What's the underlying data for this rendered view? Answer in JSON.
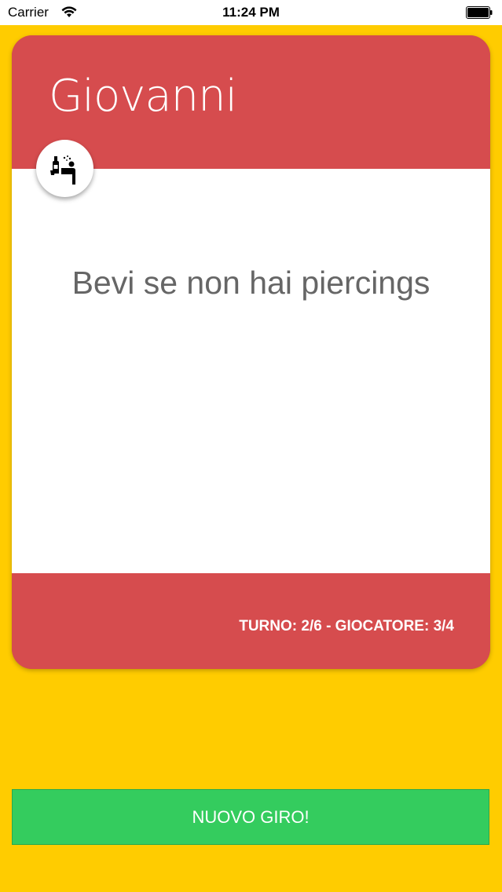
{
  "status_bar": {
    "carrier": "Carrier",
    "time": "11:24 PM"
  },
  "card": {
    "player_name": "Giovanni",
    "challenge": "Bevi se non hai piercings",
    "turn_info": "TURNO: 2/6 - GIOCATORE: 3/4",
    "category_icon": "drinking-person-icon"
  },
  "actions": {
    "new_round_label": "NUOVO GIRO!"
  },
  "colors": {
    "background": "#FFCC00",
    "card_accent": "#D64C4E",
    "button": "#34CC5E"
  }
}
